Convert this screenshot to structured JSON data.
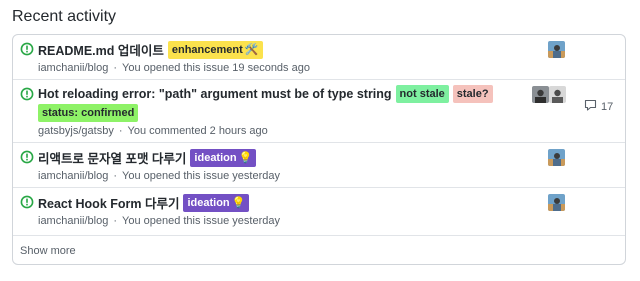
{
  "heading": "Recent activity",
  "colors": {
    "open_icon": "#28a745",
    "link_text": "#24292e",
    "meta_text": "#586069",
    "border": "#d1d5da"
  },
  "issues": [
    {
      "title": "README.md 업데이트",
      "labels": [
        {
          "text": "enhancement",
          "icon": "🛠️",
          "color": "#fbe24d",
          "text_color": "#24292e"
        }
      ],
      "repo": "iamchanii/blog",
      "activity": "You opened this issue 19 seconds ago",
      "avatars": [
        "avatar-icon"
      ]
    },
    {
      "title": "Hot reloading error: \"path\" argument must be of type string",
      "labels": [
        {
          "text": "not stale",
          "color": "#7ef0a0",
          "text_color": "#24292e"
        },
        {
          "text": "stale?",
          "color": "#f5c2bc",
          "text_color": "#24292e"
        },
        {
          "text": "status: confirmed",
          "color": "#8ef267",
          "text_color": "#24292e"
        }
      ],
      "repo": "gatsbyjs/gatsby",
      "activity": "You commented 2 hours ago",
      "avatars": [
        "avatar-icon",
        "avatar-icon"
      ],
      "comment_count": "17"
    },
    {
      "title": "리액트로 문자열 포맷 다루기",
      "labels": [
        {
          "text": "ideation",
          "icon": "💡",
          "color": "#7350c4",
          "text_color": "#ffffff"
        }
      ],
      "repo": "iamchanii/blog",
      "activity": "You opened this issue yesterday",
      "avatars": [
        "avatar-icon"
      ]
    },
    {
      "title": "React Hook Form 다루기",
      "labels": [
        {
          "text": "ideation",
          "icon": "💡",
          "color": "#7350c4",
          "text_color": "#ffffff"
        }
      ],
      "repo": "iamchanii/blog",
      "activity": "You opened this issue yesterday",
      "avatars": [
        "avatar-icon"
      ]
    }
  ],
  "show_more": "Show more"
}
